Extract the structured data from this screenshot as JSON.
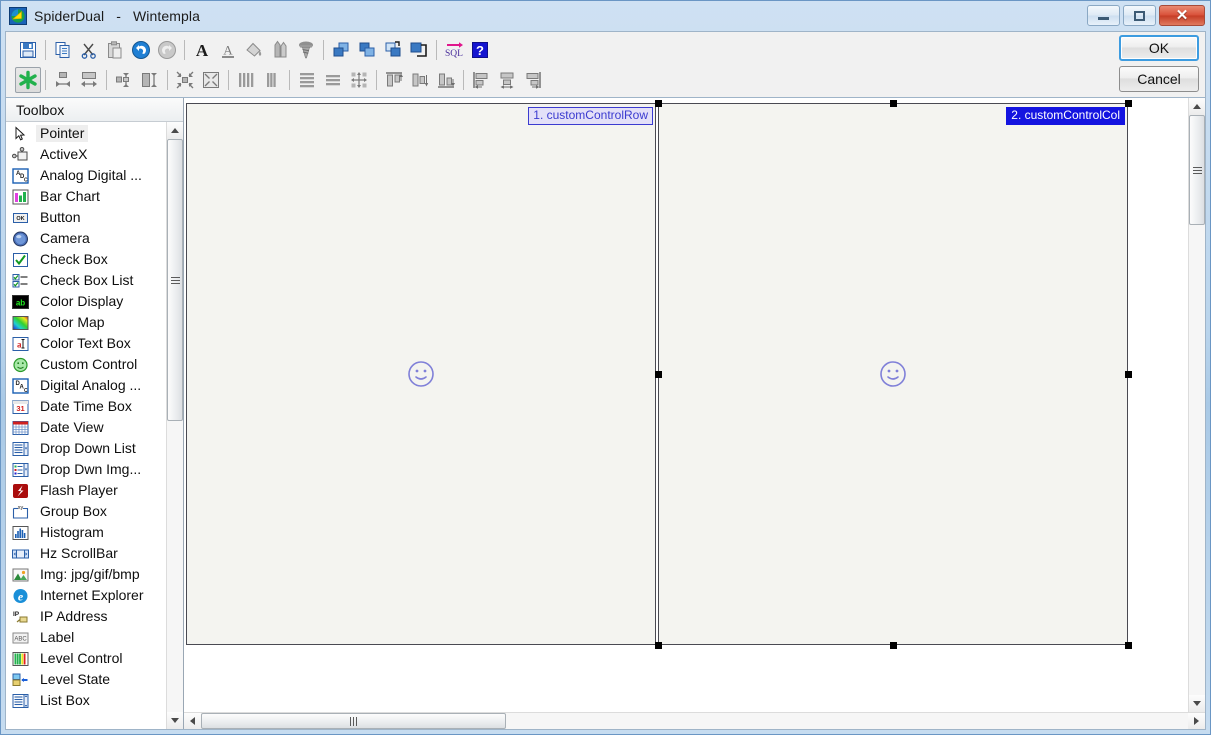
{
  "window": {
    "app_name": "SpiderDual",
    "separator": "-",
    "document_name": "Wintempla",
    "title_full": "SpiderDual   -   Wintempla",
    "icon": "spider-app-icon",
    "controls": {
      "minimize": "minimize-button",
      "maximize": "maximize-button",
      "close": "close-button",
      "close_glyph": "✕"
    }
  },
  "dialog_buttons": {
    "ok_label": "OK",
    "cancel_label": "Cancel"
  },
  "toolbar": {
    "row1": [
      {
        "name": "save-icon",
        "sep_after": true
      },
      {
        "name": "copy-icon",
        "sep_after": false
      },
      {
        "name": "cut-scissors-icon",
        "sep_after": false
      },
      {
        "name": "paste-icon",
        "sep_after": false
      },
      {
        "name": "undo-icon",
        "sep_after": false
      },
      {
        "name": "redo-icon",
        "sep_after": true
      },
      {
        "name": "bold-font-icon",
        "sep_after": false
      },
      {
        "name": "font-underline-icon",
        "sep_after": false
      },
      {
        "name": "fill-color-icon",
        "sep_after": false
      },
      {
        "name": "pencils-icon",
        "sep_after": false
      },
      {
        "name": "screw-icon",
        "sep_after": true
      },
      {
        "name": "bring-to-front-icon",
        "sep_after": false
      },
      {
        "name": "send-to-back-icon",
        "sep_after": false
      },
      {
        "name": "bring-forward-icon",
        "sep_after": false
      },
      {
        "name": "send-backward-icon",
        "sep_after": true
      },
      {
        "name": "sql-icon",
        "sep_after": false
      },
      {
        "name": "help-icon",
        "sep_after": false
      }
    ],
    "row2": [
      {
        "name": "snap-to-grid-icon",
        "pressed": true,
        "sep_after": true
      },
      {
        "name": "make-same-width-icon",
        "sep_after": false
      },
      {
        "name": "make-same-height-icon",
        "sep_after": true
      },
      {
        "name": "size-to-grid-width-icon",
        "sep_after": false
      },
      {
        "name": "size-to-grid-height-icon",
        "sep_after": true
      },
      {
        "name": "shrink-to-fit-icon",
        "sep_after": false
      },
      {
        "name": "shrink-all-icon",
        "sep_after": true
      },
      {
        "name": "space-across-icon",
        "sep_after": false
      },
      {
        "name": "remove-horizontal-space-icon",
        "sep_after": true
      },
      {
        "name": "space-down-icon",
        "sep_after": false
      },
      {
        "name": "remove-vertical-space-icon",
        "sep_after": false
      },
      {
        "name": "center-in-form-icon",
        "sep_after": true
      },
      {
        "name": "align-top-icon",
        "sep_after": false
      },
      {
        "name": "align-middle-icon",
        "sep_after": false
      },
      {
        "name": "align-bottom-icon",
        "sep_after": true
      },
      {
        "name": "align-left-icon",
        "sep_after": false
      },
      {
        "name": "align-center-icon",
        "sep_after": false
      },
      {
        "name": "align-right-icon",
        "sep_after": false
      }
    ]
  },
  "toolbox": {
    "title": "Toolbox",
    "selected_item": "Pointer",
    "items": [
      {
        "label": "Pointer",
        "icon": "pointer-icon"
      },
      {
        "label": "ActiveX",
        "icon": "activex-icon"
      },
      {
        "label": "Analog Digital ...",
        "icon": "analog-digital-icon"
      },
      {
        "label": "Bar Chart",
        "icon": "bar-chart-icon"
      },
      {
        "label": "Button",
        "icon": "button-icon"
      },
      {
        "label": "Camera",
        "icon": "camera-icon"
      },
      {
        "label": "Check Box",
        "icon": "check-box-icon"
      },
      {
        "label": "Check Box List",
        "icon": "check-box-list-icon"
      },
      {
        "label": "Color Display",
        "icon": "color-display-icon"
      },
      {
        "label": "Color Map",
        "icon": "color-map-icon"
      },
      {
        "label": "Color Text Box",
        "icon": "color-text-box-icon"
      },
      {
        "label": "Custom Control",
        "icon": "custom-control-icon"
      },
      {
        "label": "Digital Analog ...",
        "icon": "digital-analog-icon"
      },
      {
        "label": "Date Time Box",
        "icon": "date-time-box-icon"
      },
      {
        "label": "Date View",
        "icon": "date-view-icon"
      },
      {
        "label": "Drop Down List",
        "icon": "drop-down-list-icon"
      },
      {
        "label": "Drop Dwn Img...",
        "icon": "drop-down-image-icon"
      },
      {
        "label": "Flash Player",
        "icon": "flash-player-icon"
      },
      {
        "label": "Group Box",
        "icon": "group-box-icon"
      },
      {
        "label": "Histogram",
        "icon": "histogram-icon"
      },
      {
        "label": "Hz ScrollBar",
        "icon": "horizontal-scrollbar-icon"
      },
      {
        "label": "Img: jpg/gif/bmp",
        "icon": "image-icon"
      },
      {
        "label": "Internet Explorer",
        "icon": "internet-explorer-icon"
      },
      {
        "label": "IP Address",
        "icon": "ip-address-icon"
      },
      {
        "label": "Label",
        "icon": "label-icon"
      },
      {
        "label": "Level Control",
        "icon": "level-control-icon"
      },
      {
        "label": "Level State",
        "icon": "level-state-icon"
      },
      {
        "label": "List Box",
        "icon": "list-box-icon"
      }
    ]
  },
  "canvas": {
    "panels": [
      {
        "index": "1.",
        "name": "customControlRow",
        "label": "1. customControlRow",
        "selected": false,
        "glyph": "custom-control-smiley-icon"
      },
      {
        "index": "2.",
        "name": "customControlCol",
        "label": "2. customControlCol",
        "selected": true,
        "glyph": "custom-control-smiley-icon"
      }
    ]
  },
  "colors": {
    "label_unselected_bg": "#e3e0f8",
    "label_unselected_fg": "#3b3bd0",
    "label_selected_bg": "#1414e0",
    "label_selected_fg": "#ffffff",
    "panel_bg": "#f4f4f0",
    "smiley": "#8080d8",
    "titlebar": "#b9d4ec",
    "close_button": "#d9513a"
  }
}
